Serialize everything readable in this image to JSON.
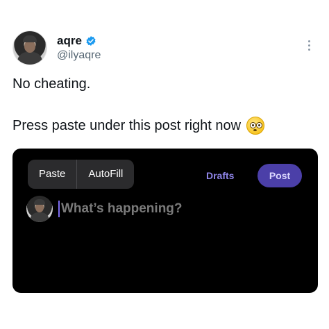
{
  "author": {
    "display_name": "aqre",
    "handle": "@ilyaqre"
  },
  "post": {
    "line1": "No cheating.",
    "line2": "Press paste under this post right now"
  },
  "compose": {
    "context_menu": [
      "Paste",
      "AutoFill"
    ],
    "drafts_label": "Drafts",
    "post_label": "Post",
    "placeholder": "What’s happening?"
  },
  "colors": {
    "verified": "#1d9bf0",
    "accent": "#4b3fa8",
    "panel_background": "#000000"
  }
}
